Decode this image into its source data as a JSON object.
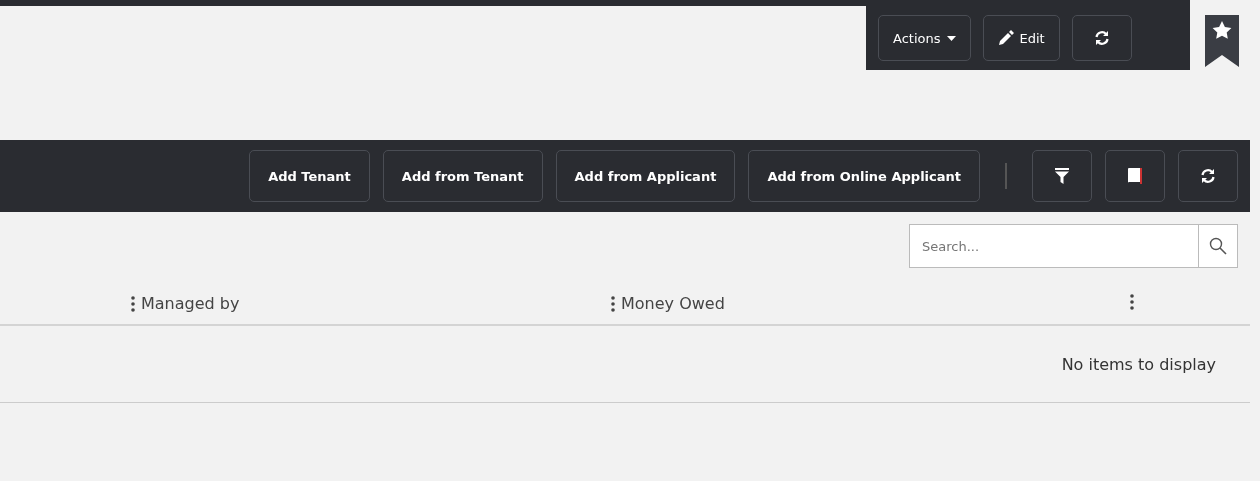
{
  "header_actions": [
    {
      "kind": "dropdown",
      "label": "Actions"
    },
    {
      "kind": "edit",
      "label": "Edit"
    },
    {
      "kind": "refresh"
    }
  ],
  "toolbar": {
    "buttons": [
      {
        "kind": "text",
        "label": "Add Tenant"
      },
      {
        "kind": "text",
        "label": "Add from Tenant"
      },
      {
        "kind": "text",
        "label": "Add from Applicant"
      },
      {
        "kind": "text",
        "label": "Add from Online Applicant"
      },
      {
        "kind": "separator"
      },
      {
        "kind": "filter"
      },
      {
        "kind": "book"
      },
      {
        "kind": "refresh"
      }
    ]
  },
  "search": {
    "placeholder": "Search..."
  },
  "table": {
    "columns": [
      {
        "label": "Managed by"
      },
      {
        "label": "Money Owed"
      },
      {}
    ],
    "empty_message": "No items to display"
  }
}
